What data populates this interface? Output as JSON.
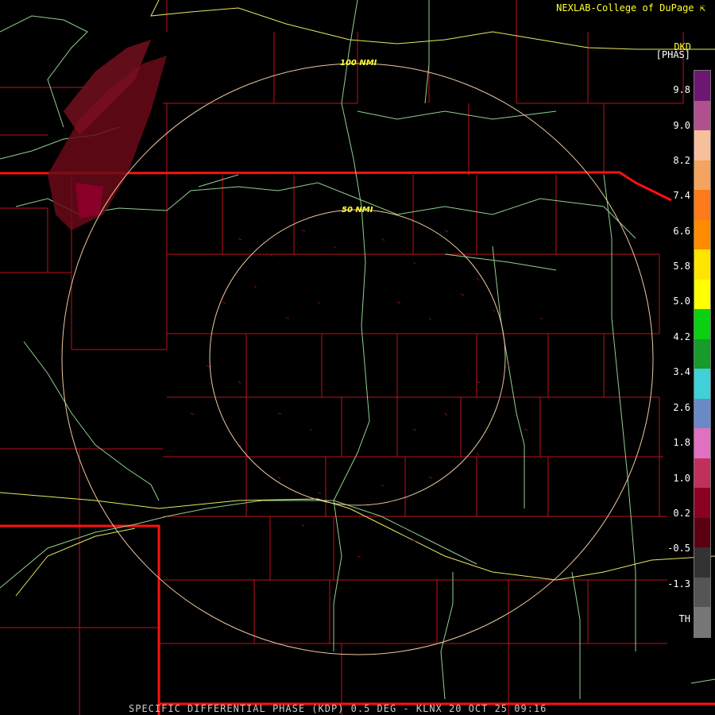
{
  "header": {
    "credit": "NEXLAB-College of DuPage",
    "product_code": "DKD",
    "units": "[PHAS]"
  },
  "range_rings": {
    "outer_label": "100 NMI",
    "inner_label": "50 NMI"
  },
  "legend": {
    "labels": [
      "9.8",
      "9.0",
      "8.2",
      "7.4",
      "6.6",
      "5.8",
      "5.0",
      "4.2",
      "3.4",
      "2.6",
      "1.8",
      "1.0",
      "0.2",
      "-0.5",
      "-1.3",
      "TH"
    ],
    "colors": [
      "#6d1770",
      "#b0508f",
      "#f6c09d",
      "#f5a35f",
      "#ff7a1a",
      "#ff8c00",
      "#ffe400",
      "#ffff00",
      "#0bd012",
      "#179b2b",
      "#40d0d8",
      "#6a8ac7",
      "#e070c0",
      "#c0305a",
      "#8a0020",
      "#5a0010",
      "#333333",
      "#555555",
      "#777777"
    ],
    "icon": "color-scale-bar"
  },
  "caption": "SPECIFIC DIFFERENTIAL PHASE (KDP) 0.5 DEG - KLNX 20 OCT 25 09:16",
  "colors": {
    "background": "#000000",
    "county_lines": "#c0101a",
    "state_lines": "#ff1010",
    "rivers": "#8fd08f",
    "roads": "#e8e860",
    "range_rings": "#f0c8a0",
    "text": "#ffff33"
  }
}
